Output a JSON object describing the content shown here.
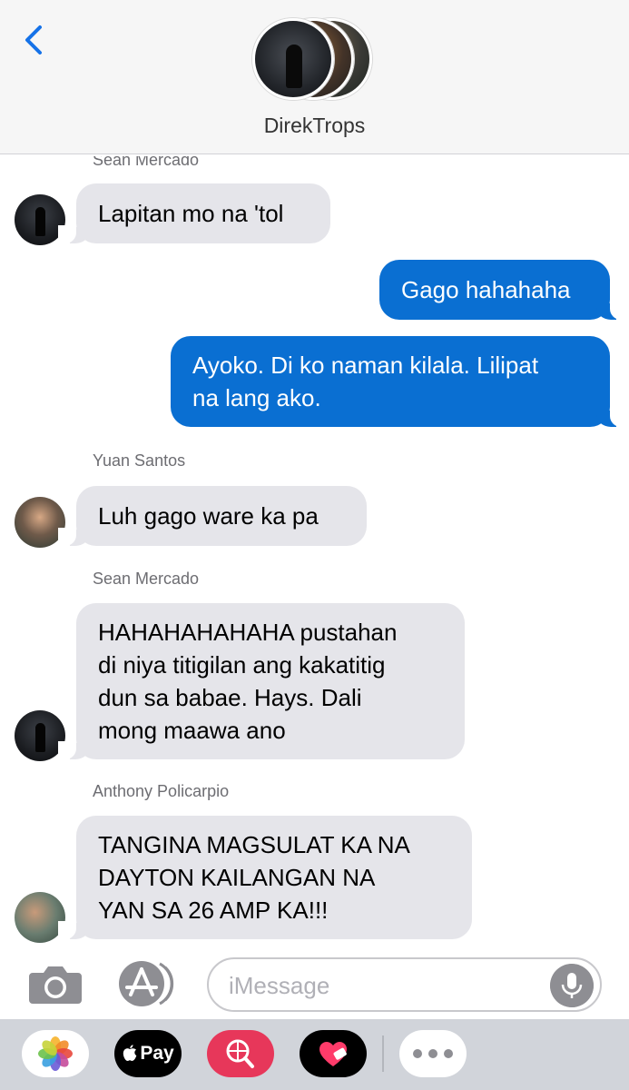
{
  "header": {
    "group_name": "DirekTrops"
  },
  "messages": [
    {
      "sender": "Sean Mercado",
      "text": "Lapitan mo na 'tol",
      "direction": "received"
    },
    {
      "sender": "",
      "text": "Gago hahahaha",
      "direction": "sent"
    },
    {
      "sender": "",
      "text_lines": [
        "Ayoko. Di ko naman kilala. Lilipat",
        "na lang ako."
      ],
      "direction": "sent"
    },
    {
      "sender": "Yuan Santos",
      "text": "Luh gago ware ka pa",
      "direction": "received"
    },
    {
      "sender": "Sean Mercado",
      "text_lines": [
        "HAHAHAHAHAHA pustahan",
        "di niya titigilan ang kakatitig",
        "dun sa babae. Hays. Dali",
        "mong maawa ano"
      ],
      "direction": "received"
    },
    {
      "sender": "Anthony Policarpio",
      "text_lines": [
        "TANGINA MAGSULAT KA NA",
        "DAYTON KAILANGAN NA",
        "YAN SA 26 AMP KA!!!"
      ],
      "direction": "received"
    }
  ],
  "input": {
    "placeholder": "iMessage"
  },
  "app_drawer": {
    "apple_pay_label": "Pay"
  },
  "colors": {
    "sent_bubble": "#0a6fd2",
    "received_bubble": "#e5e5ea",
    "accent": "#0a6fd2"
  },
  "icons": [
    "back-chevron-icon",
    "camera-icon",
    "app-store-icon",
    "microphone-icon",
    "photos-icon",
    "apple-logo-icon",
    "search-globe-icon",
    "heart-icon",
    "more-icon"
  ]
}
